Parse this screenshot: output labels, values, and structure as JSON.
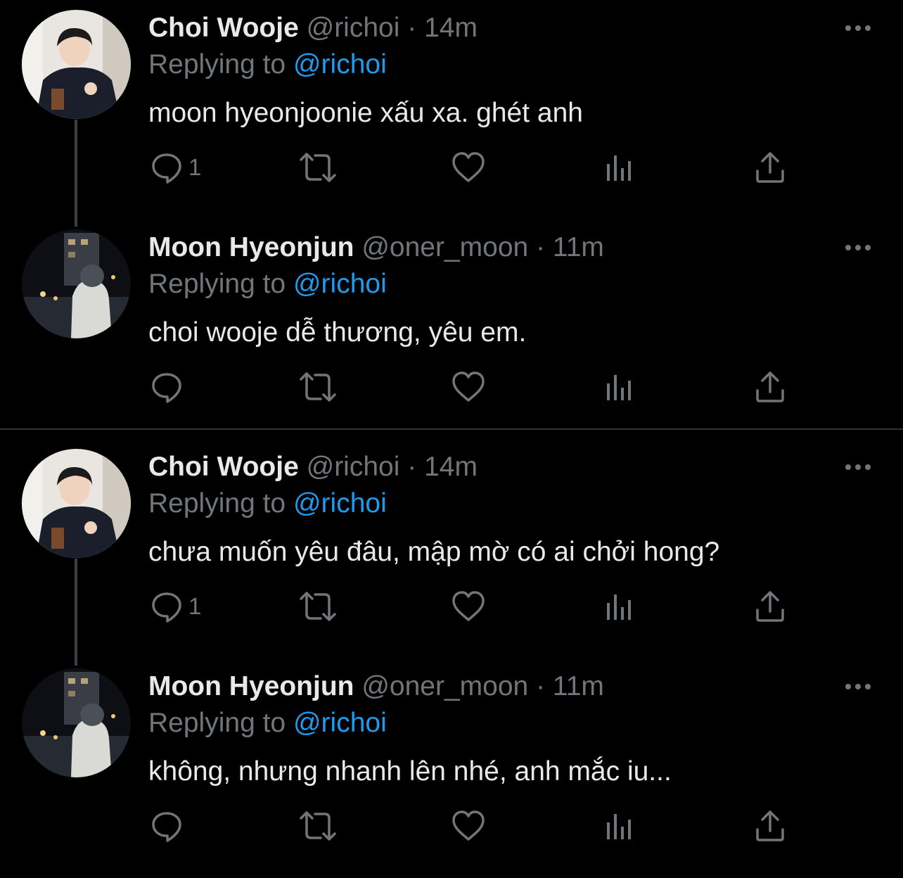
{
  "threads": [
    {
      "tweets": [
        {
          "display_name": "Choi Wooje",
          "handle": "@richoi",
          "separator": "·",
          "time": "14m",
          "replying_prefix": "Replying to",
          "replying_to": "@richoi",
          "text": "moon hyeonjoonie xấu xa. ghét anh",
          "reply_count": "1",
          "avatar_icon": "avatar-choi-wooje"
        },
        {
          "display_name": "Moon Hyeonjun",
          "handle": "@oner_moon",
          "separator": "·",
          "time": "11m",
          "replying_prefix": "Replying to",
          "replying_to": "@richoi",
          "text": "choi wooje dễ thương, yêu em.",
          "reply_count": "",
          "avatar_icon": "avatar-moon-hyeonjun"
        }
      ]
    },
    {
      "tweets": [
        {
          "display_name": "Choi Wooje",
          "handle": "@richoi",
          "separator": "·",
          "time": "14m",
          "replying_prefix": "Replying to",
          "replying_to": "@richoi",
          "text": "chưa muốn yêu đâu, mập mờ có ai chởi hong?",
          "reply_count": "1",
          "avatar_icon": "avatar-choi-wooje"
        },
        {
          "display_name": "Moon Hyeonjun",
          "handle": "@oner_moon",
          "separator": "·",
          "time": "11m",
          "replying_prefix": "Replying to",
          "replying_to": "@richoi",
          "text": "không, nhưng nhanh lên nhé, anh mắc iu...",
          "reply_count": "",
          "avatar_icon": "avatar-moon-hyeonjun"
        }
      ]
    }
  ],
  "icons": {
    "reply": "reply-icon",
    "retweet": "retweet-icon",
    "like": "heart-icon",
    "views": "views-icon",
    "share": "share-icon",
    "more": "more-icon"
  },
  "colors": {
    "background": "#000000",
    "primary_text": "#e7e9ea",
    "secondary_text": "#71767b",
    "accent": "#1d9bf0",
    "thread_line": "#3b3f43",
    "divider": "#2f3336"
  }
}
